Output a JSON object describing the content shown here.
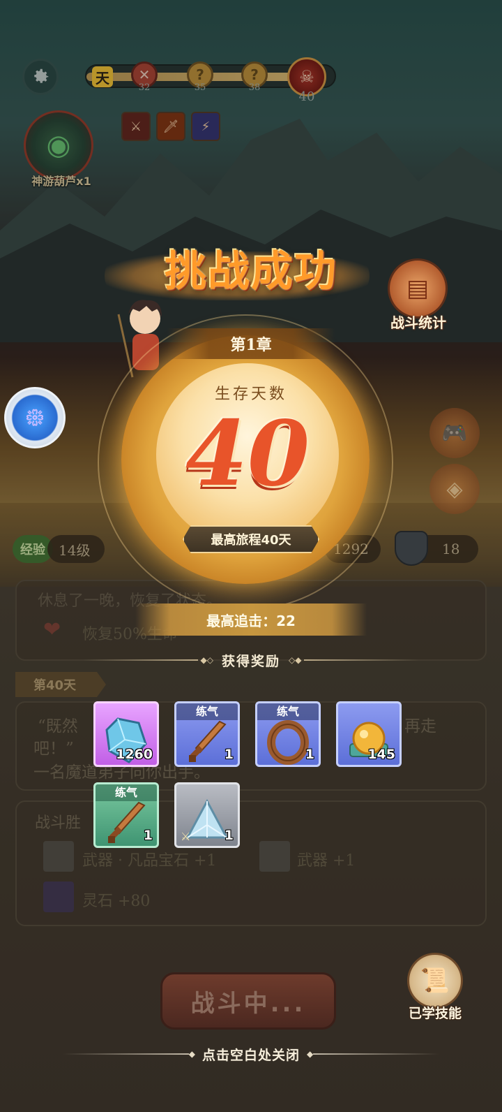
{
  "hud": {
    "day_char": "天",
    "nodes": [
      {
        "icon": "✕",
        "num": "32",
        "state": "cleared"
      },
      {
        "icon": "?",
        "num": "35",
        "state": "unknown"
      },
      {
        "icon": "?",
        "num": "38",
        "state": "unknown"
      },
      {
        "icon": "☠",
        "num": "40",
        "state": "boss"
      }
    ],
    "progress_fraction": 0.85,
    "gourd_label": "神游葫芦x1",
    "buffs": [
      "sword-buff",
      "blade-buff",
      "lightning-buff"
    ]
  },
  "result": {
    "title": "挑战成功",
    "chapter": "第1章",
    "survive_label": "生存天数",
    "days": "40",
    "best_journey": "最高旅程40天",
    "best_chase": "最高追击：22",
    "rewards_header": "获得奖励"
  },
  "side": {
    "stats_label": "战斗统计"
  },
  "stats_strip": {
    "xp_badge": "经验",
    "level": "14级",
    "power": "1292",
    "shield": "18"
  },
  "log": {
    "line1": "休息了一晚，恢复了状态。",
    "heal": "恢复50%生命",
    "day_tag": "第40天",
    "quote_left": "“既然",
    "quote_right": "再走",
    "quote_line2": "吧！”",
    "quote_line3": "一名魔道弟子向你出手。",
    "battle_win": "战斗胜",
    "loot1": "武器 · 凡品宝石 +1",
    "loot2": "武器 +1",
    "loot3": "灵石 +80"
  },
  "rewards": [
    {
      "tier": "",
      "count": "1260",
      "icon": "crystal-icon",
      "rarity": "purple"
    },
    {
      "tier": "练气",
      "count": "1",
      "icon": "wooden-sword-icon",
      "rarity": "blue"
    },
    {
      "tier": "练气",
      "count": "1",
      "icon": "ring-icon",
      "rarity": "blue"
    },
    {
      "tier": "",
      "count": "145",
      "icon": "golden-orb-icon",
      "rarity": "blue"
    },
    {
      "tier": "练气",
      "count": "1",
      "icon": "wooden-sword-icon",
      "rarity": "green"
    },
    {
      "tier": "",
      "count": "1",
      "icon": "triangle-gem-icon",
      "rarity": "grey"
    }
  ],
  "bottom": {
    "fight_button": "战斗中...",
    "skills_label": "已学技能",
    "close_hint": "点击空白处关闭"
  }
}
